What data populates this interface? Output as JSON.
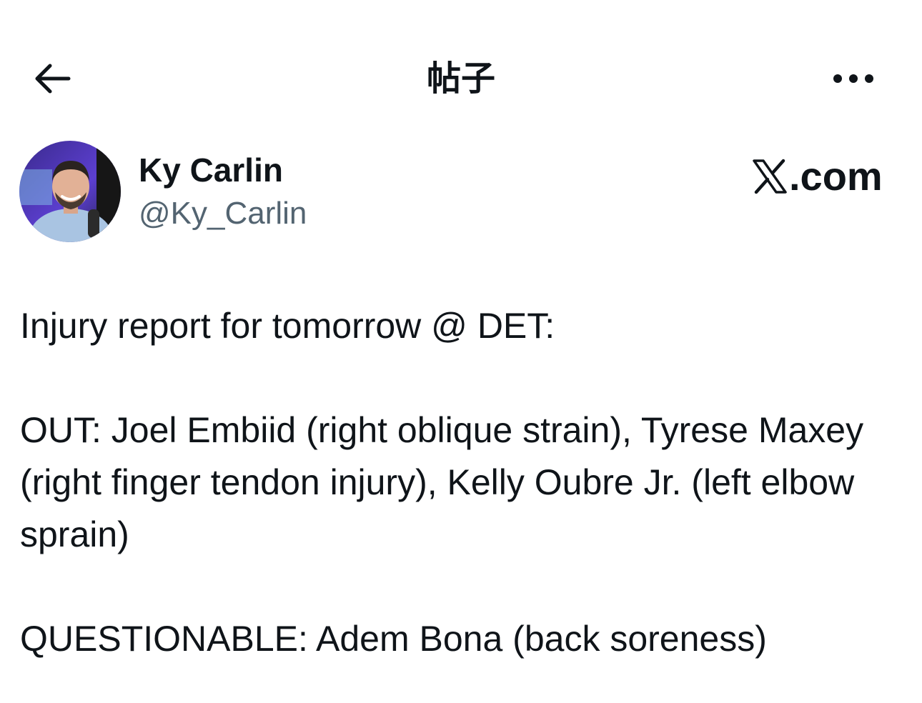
{
  "header": {
    "title": "帖子",
    "back_icon": "arrow-left-icon",
    "more_icon": "more-horizontal-icon"
  },
  "author": {
    "name": "Ky Carlin",
    "handle": "@Ky_Carlin",
    "avatar_icon": "user-avatar"
  },
  "source": {
    "logo_icon": "x-logo-icon",
    "label": ".com"
  },
  "post": {
    "line_1": "Injury report for tomorrow @ DET:",
    "out_paragraph": "OUT: Joel Embiid (right oblique strain), Tyrese Maxey (right finger tendon injury), Kelly Oubre Jr. (left elbow sprain)",
    "questionable_paragraph": "QUESTIONABLE: Adem Bona (back soreness)"
  },
  "colors": {
    "text_primary": "#0f1419",
    "text_secondary": "#536471",
    "background": "#ffffff"
  }
}
